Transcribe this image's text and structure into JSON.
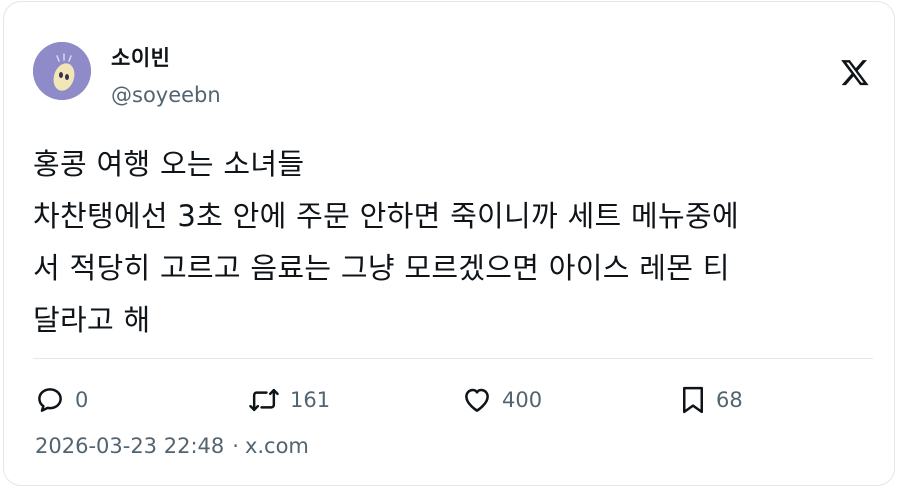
{
  "author": {
    "name": "소이빈",
    "handle": "@soyeebn"
  },
  "post": {
    "lines": [
      "홍콩 여행 오는 소녀들",
      "차찬탱에선 3초 안에 주문 안하면 죽이니까 세트 메뉴중에",
      "서 적당히 고르고 음료는 그냥 모르겠으면 아이스 레몬 티",
      "달라고 해"
    ]
  },
  "actions": {
    "replies": "0",
    "reposts": "161",
    "likes": "400",
    "bookmarks": "68"
  },
  "footer": {
    "timestamp": "2026-03-23 22:48",
    "separator": "·",
    "source": "x.com"
  },
  "icons": {
    "brand": "x-logo-icon",
    "reply": "reply-icon",
    "repost": "repost-icon",
    "like": "heart-icon",
    "bookmark": "bookmark-icon"
  },
  "colors": {
    "text": "#0f1419",
    "secondary": "#536471",
    "avatar_bg": "#8f8bc9",
    "divider": "#e6e9ec"
  }
}
